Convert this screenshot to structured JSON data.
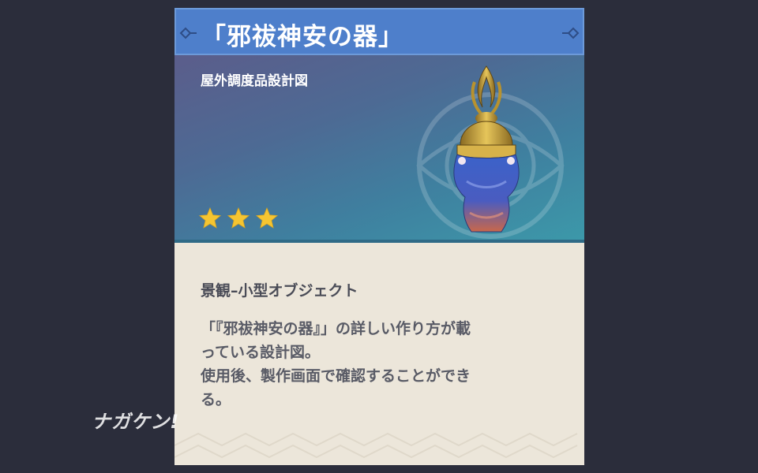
{
  "item": {
    "name": "「邪祓神安の器」",
    "type": "屋外調度品設計図",
    "rarity_stars": 3,
    "category": "景観–小型オブジェクト",
    "description_lines": [
      "「『邪祓神安の器』」の詳しい作り方が載",
      "っている設計図。",
      "使用後、製作画面で確認することができ",
      "る。"
    ]
  },
  "watermark": {
    "logo_text": "ナガケン!"
  },
  "colors": {
    "background": "#2b2d3b",
    "title_bar": "#4e7fcb",
    "star": "#f5c531",
    "body": "#ece6da",
    "text_dark": "#4a4c57"
  },
  "icons": {
    "item_image": "vase-icon",
    "star": "star-icon",
    "corner": "ornament-icon"
  }
}
